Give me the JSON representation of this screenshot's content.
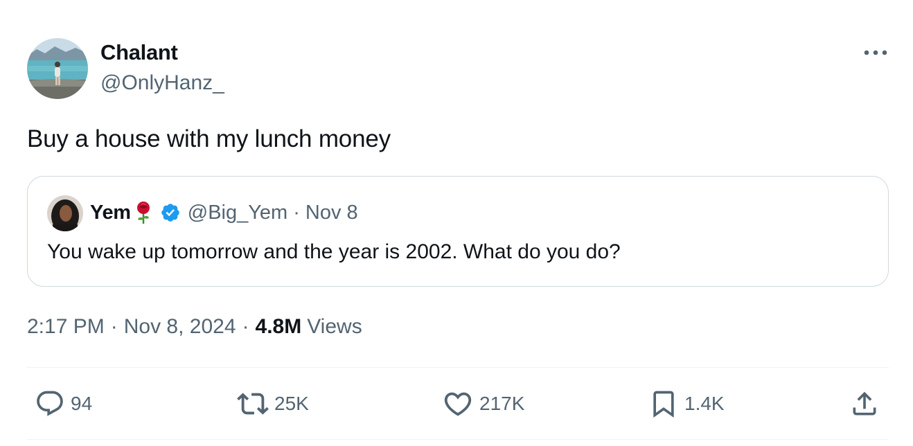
{
  "author": {
    "display_name": "Chalant",
    "handle": "@OnlyHanz_",
    "avatar_icon": "profile-photo-beach"
  },
  "tweet": {
    "text": "Buy a house with my lunch money"
  },
  "quoted_tweet": {
    "display_name": "Yem",
    "emoji_icon": "rose-emoji",
    "verified_icon": "verified-badge",
    "handle": "@Big_Yem",
    "separator": "·",
    "date": "Nov 8",
    "text": "You wake up tomorrow and the year is 2002. What do you do?"
  },
  "meta": {
    "time": "2:17 PM",
    "separator": "·",
    "date": "Nov 8, 2024",
    "separator2": "·",
    "views_count": "4.8M",
    "views_label": "Views"
  },
  "actions": {
    "replies": "94",
    "reposts": "25K",
    "likes": "217K",
    "bookmarks": "1.4K"
  },
  "colors": {
    "text_primary": "#0f1419",
    "text_secondary": "#536471",
    "border": "#cfd9de",
    "verified_blue": "#1d9bf0"
  }
}
